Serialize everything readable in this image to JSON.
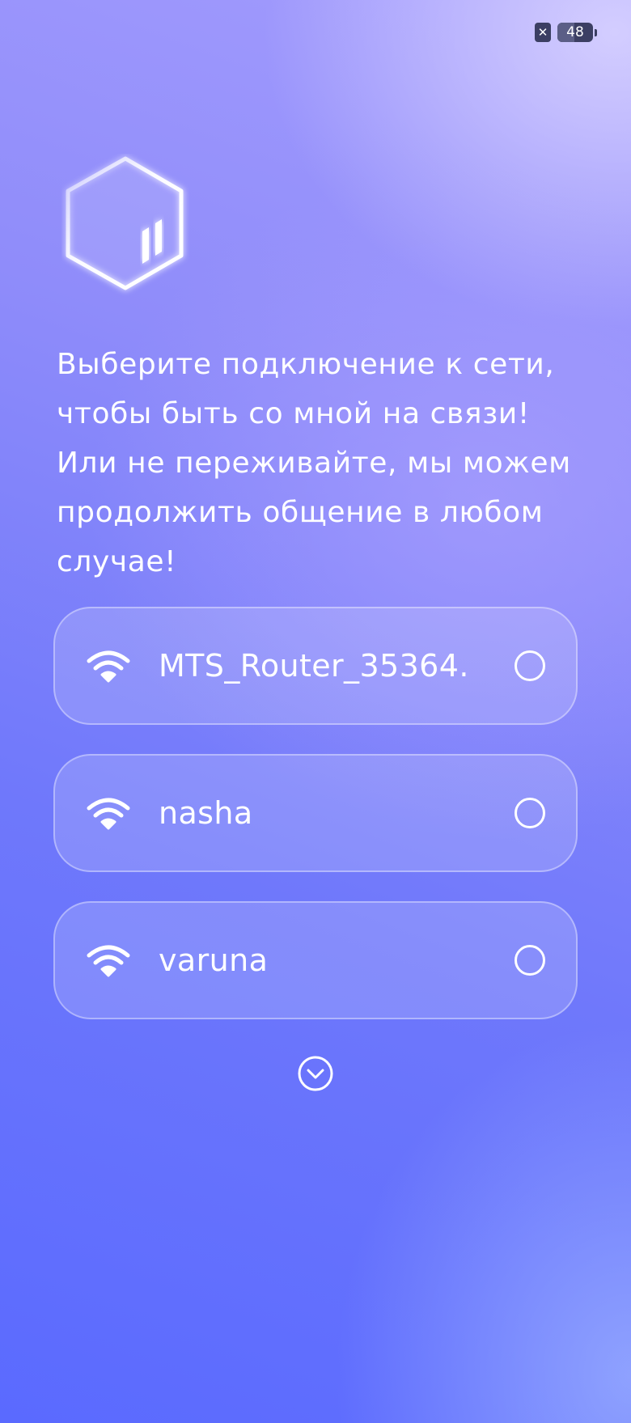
{
  "status_bar": {
    "notification_icon": "close-x-icon",
    "battery_level": "48",
    "battery_fill_fraction": 0.48
  },
  "logo": {
    "icon": "hexagon-bars-logo"
  },
  "message": "Выберите подключение к сети,\nчтобы быть со мной на связи!\nИли не переживайте, мы можем\nпродолжить общение в любом\nслучае!",
  "networks": [
    {
      "name": "MTS_Router_35364.",
      "icon": "wifi-icon",
      "selected": false
    },
    {
      "name": "nasha",
      "icon": "wifi-icon",
      "selected": false
    },
    {
      "name": "varuna",
      "icon": "wifi-icon",
      "selected": false
    }
  ],
  "more_button": {
    "icon": "chevron-down-circle-icon"
  },
  "colors": {
    "background_top": "#a39cfd",
    "background_bottom": "#5a6aff",
    "text": "#ffffff",
    "status_badge": "#3c3f63"
  }
}
